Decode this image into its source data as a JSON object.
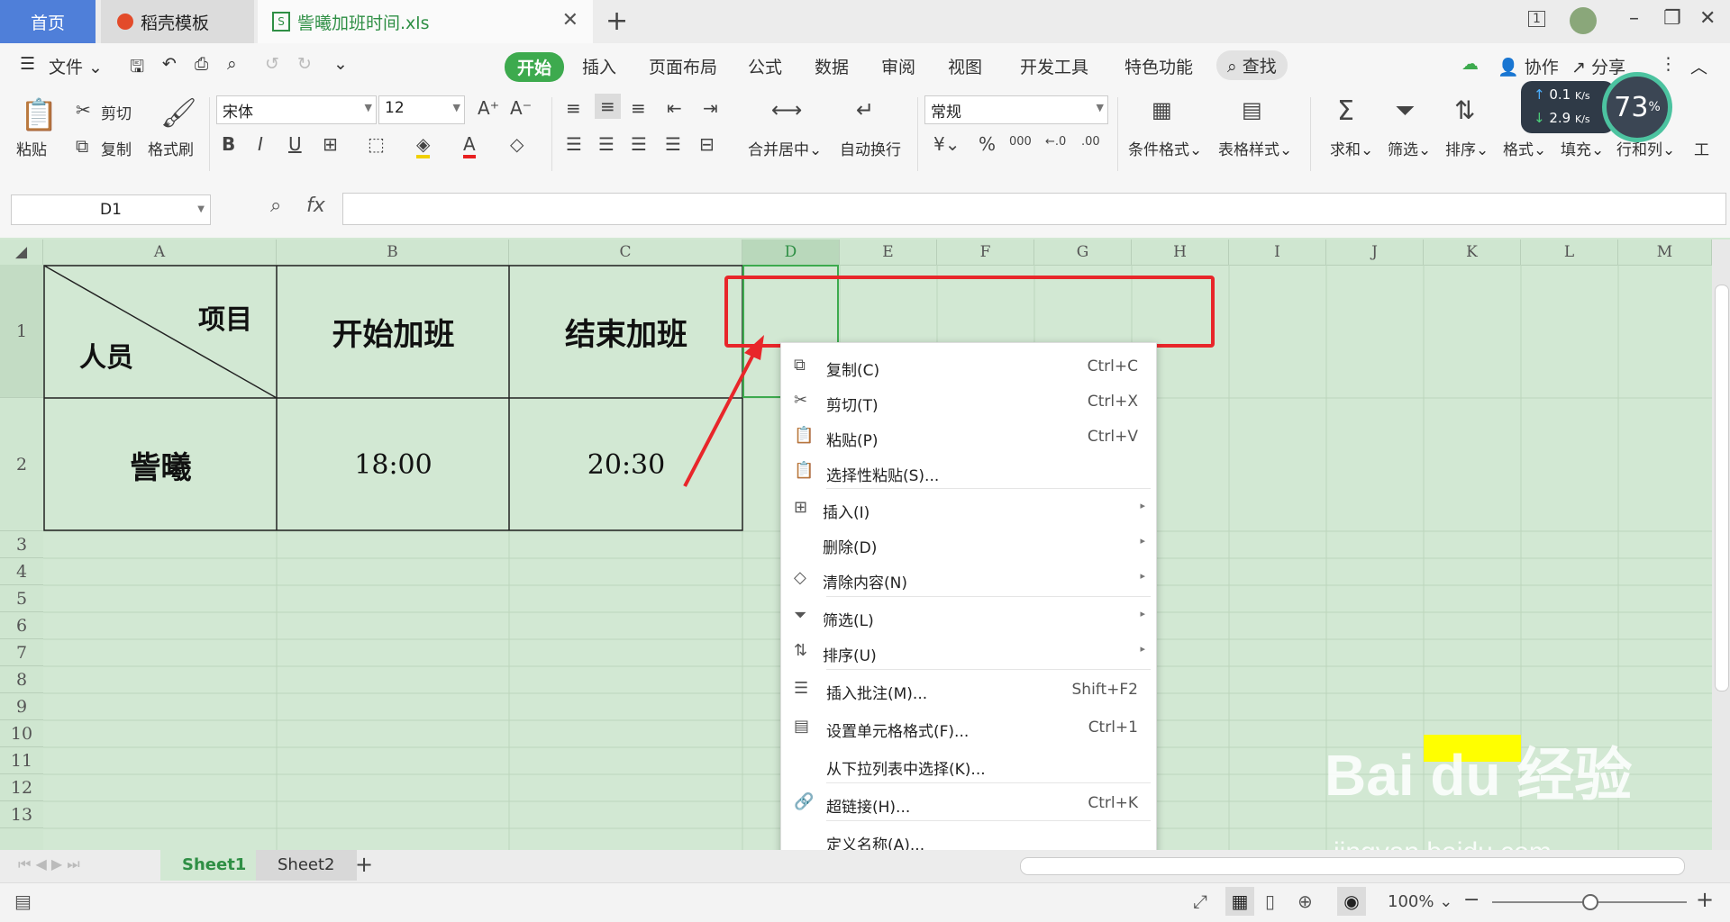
{
  "titlebar": {
    "tabs": [
      {
        "label": "首页"
      },
      {
        "label": "稻壳模板"
      },
      {
        "label": "訾曦加班时间.xls"
      }
    ],
    "add": "+",
    "page_badge": "1"
  },
  "menubar": {
    "file": "文件",
    "items": [
      "开始",
      "插入",
      "页面布局",
      "公式",
      "数据",
      "审阅",
      "视图",
      "开发工具",
      "特色功能"
    ],
    "search": "查找",
    "collab": "协作",
    "share": "分享"
  },
  "ribbon": {
    "paste": "粘贴",
    "cut": "剪切",
    "copy": "复制",
    "format_painter": "格式刷",
    "font": "宋体",
    "size": "12",
    "merge": "合并居中",
    "wrap": "自动换行",
    "number_format": "常规",
    "conditional": "条件格式",
    "table_style": "表格样式",
    "sum": "求和",
    "filter": "筛选",
    "sort": "排序",
    "format": "格式",
    "fill": "填充",
    "rowcol": "行和列",
    "tools": "工"
  },
  "speed": {
    "up": "0.1",
    "down": "2.9",
    "unit": "K/s",
    "percent": "73"
  },
  "formulabar": {
    "namebox": "D1",
    "fx": "fx"
  },
  "grid": {
    "columns": [
      "A",
      "B",
      "C",
      "D",
      "E",
      "F",
      "G",
      "H",
      "I",
      "J",
      "K",
      "L",
      "M"
    ],
    "rows": [
      "1",
      "2",
      "3",
      "4",
      "5",
      "6",
      "7",
      "8",
      "9",
      "10",
      "11",
      "12",
      "13"
    ],
    "header_top": "项目",
    "header_bottom": "人员",
    "b1": "开始加班",
    "c1": "结束加班",
    "a2": "訾曦",
    "b2": "18:00",
    "c2": "20:30"
  },
  "context_menu": [
    {
      "label": "复制(C)",
      "shortcut": "Ctrl+C",
      "icon": "copy-icon"
    },
    {
      "label": "剪切(T)",
      "shortcut": "Ctrl+X",
      "icon": "scissors-icon"
    },
    {
      "label": "粘贴(P)",
      "shortcut": "Ctrl+V",
      "icon": "paste-icon"
    },
    {
      "label": "选择性粘贴(S)...",
      "shortcut": "",
      "icon": "paste-special-icon"
    },
    {
      "label": "插入(I)",
      "shortcut": "",
      "icon": "insert-icon"
    },
    {
      "label": "删除(D)",
      "shortcut": "",
      "icon": ""
    },
    {
      "label": "清除内容(N)",
      "shortcut": "",
      "icon": "eraser-icon"
    },
    {
      "label": "筛选(L)",
      "shortcut": "",
      "icon": "filter-icon"
    },
    {
      "label": "排序(U)",
      "shortcut": "",
      "icon": "sort-icon"
    },
    {
      "label": "插入批注(M)...",
      "shortcut": "Shift+F2",
      "icon": "comment-icon"
    },
    {
      "label": "设置单元格格式(F)...",
      "shortcut": "Ctrl+1",
      "icon": "format-cells-icon"
    },
    {
      "label": "从下拉列表中选择(K)...",
      "shortcut": "",
      "icon": ""
    },
    {
      "label": "超链接(H)...",
      "shortcut": "Ctrl+K",
      "icon": "link-icon"
    },
    {
      "label": "定义名称(A)...",
      "shortcut": "",
      "icon": ""
    }
  ],
  "sheets": [
    "Sheet1",
    "Sheet2"
  ],
  "status": {
    "zoom": "100%"
  },
  "watermark": {
    "brand": "Bai du 经验",
    "url": "jingyan.baidu.com"
  },
  "colors": {
    "accent": "#3daa4e",
    "highlight": "#e8262a",
    "sheet_bg": "#d2e8d3"
  }
}
